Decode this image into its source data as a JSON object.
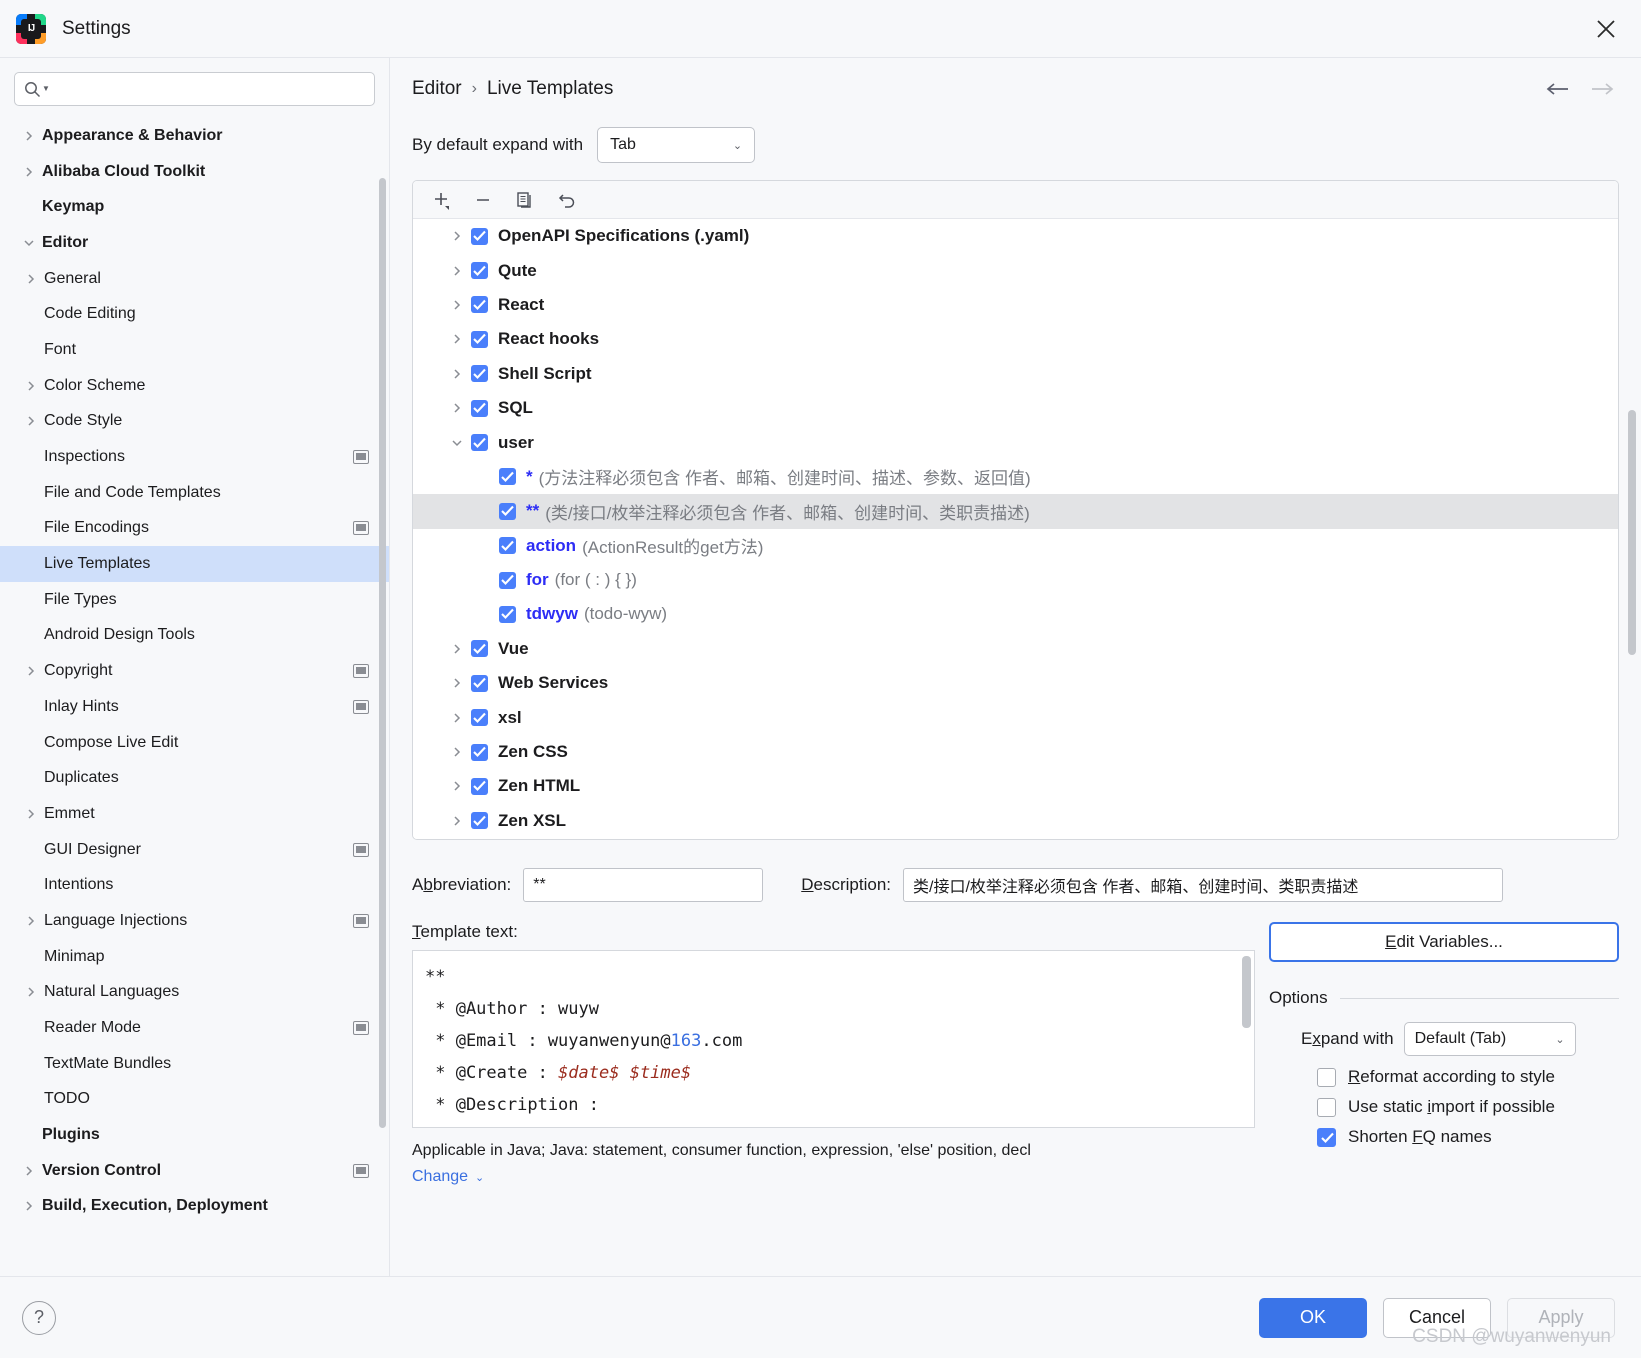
{
  "window": {
    "title": "Settings",
    "app_icon": "intellij-idea-icon",
    "close_icon": "close-icon"
  },
  "search": {
    "value": "",
    "placeholder": "",
    "icon": "search-icon"
  },
  "sidebar": {
    "items": [
      {
        "label": "Appearance & Behavior",
        "level": 1,
        "arrow": "right",
        "bold": true,
        "badge": false
      },
      {
        "label": "Alibaba Cloud Toolkit",
        "level": 1,
        "arrow": "right",
        "bold": true,
        "badge": false
      },
      {
        "label": "Keymap",
        "level": 1,
        "arrow": "none",
        "bold": true,
        "badge": false
      },
      {
        "label": "Editor",
        "level": 1,
        "arrow": "down",
        "bold": true,
        "badge": false
      },
      {
        "label": "General",
        "level": 2,
        "arrow": "right",
        "bold": false,
        "badge": false
      },
      {
        "label": "Code Editing",
        "level": 2,
        "arrow": "none",
        "bold": false,
        "badge": false
      },
      {
        "label": "Font",
        "level": 2,
        "arrow": "none",
        "bold": false,
        "badge": false
      },
      {
        "label": "Color Scheme",
        "level": 2,
        "arrow": "right",
        "bold": false,
        "badge": false
      },
      {
        "label": "Code Style",
        "level": 2,
        "arrow": "right",
        "bold": false,
        "badge": false
      },
      {
        "label": "Inspections",
        "level": 2,
        "arrow": "none",
        "bold": false,
        "badge": true
      },
      {
        "label": "File and Code Templates",
        "level": 2,
        "arrow": "none",
        "bold": false,
        "badge": false
      },
      {
        "label": "File Encodings",
        "level": 2,
        "arrow": "none",
        "bold": false,
        "badge": true
      },
      {
        "label": "Live Templates",
        "level": 2,
        "arrow": "none",
        "bold": false,
        "badge": false,
        "selected": true
      },
      {
        "label": "File Types",
        "level": 2,
        "arrow": "none",
        "bold": false,
        "badge": false
      },
      {
        "label": "Android Design Tools",
        "level": 2,
        "arrow": "none",
        "bold": false,
        "badge": false
      },
      {
        "label": "Copyright",
        "level": 2,
        "arrow": "right",
        "bold": false,
        "badge": true
      },
      {
        "label": "Inlay Hints",
        "level": 2,
        "arrow": "none",
        "bold": false,
        "badge": true
      },
      {
        "label": "Compose Live Edit",
        "level": 2,
        "arrow": "none",
        "bold": false,
        "badge": false
      },
      {
        "label": "Duplicates",
        "level": 2,
        "arrow": "none",
        "bold": false,
        "badge": false
      },
      {
        "label": "Emmet",
        "level": 2,
        "arrow": "right",
        "bold": false,
        "badge": false
      },
      {
        "label": "GUI Designer",
        "level": 2,
        "arrow": "none",
        "bold": false,
        "badge": true
      },
      {
        "label": "Intentions",
        "level": 2,
        "arrow": "none",
        "bold": false,
        "badge": false
      },
      {
        "label": "Language Injections",
        "level": 2,
        "arrow": "right",
        "bold": false,
        "badge": true
      },
      {
        "label": "Minimap",
        "level": 2,
        "arrow": "none",
        "bold": false,
        "badge": false
      },
      {
        "label": "Natural Languages",
        "level": 2,
        "arrow": "right",
        "bold": false,
        "badge": false
      },
      {
        "label": "Reader Mode",
        "level": 2,
        "arrow": "none",
        "bold": false,
        "badge": true
      },
      {
        "label": "TextMate Bundles",
        "level": 2,
        "arrow": "none",
        "bold": false,
        "badge": false
      },
      {
        "label": "TODO",
        "level": 2,
        "arrow": "none",
        "bold": false,
        "badge": false
      },
      {
        "label": "Plugins",
        "level": 1,
        "arrow": "none",
        "bold": true,
        "badge": false
      },
      {
        "label": "Version Control",
        "level": 1,
        "arrow": "right",
        "bold": true,
        "badge": true
      },
      {
        "label": "Build, Execution, Deployment",
        "level": 1,
        "arrow": "right",
        "bold": true,
        "badge": false
      }
    ]
  },
  "breadcrumb": {
    "parent": "Editor",
    "separator": "›",
    "current": "Live Templates",
    "back_icon": "arrow-left-icon",
    "forward_icon": "arrow-right-icon"
  },
  "expand_with": {
    "label": "By default expand with",
    "value": "Tab",
    "chevron": "⌄"
  },
  "toolbar": {
    "add_icon": "add-icon",
    "remove_icon": "remove-icon",
    "duplicate_icon": "duplicate-icon",
    "revert_icon": "revert-icon"
  },
  "template_tree": {
    "rows": [
      {
        "kind": "group",
        "arrow": "right",
        "label": "OpenAPI Specifications (.yaml)",
        "checked": true
      },
      {
        "kind": "group",
        "arrow": "right",
        "label": "Qute",
        "checked": true
      },
      {
        "kind": "group",
        "arrow": "right",
        "label": "React",
        "checked": true
      },
      {
        "kind": "group",
        "arrow": "right",
        "label": "React hooks",
        "checked": true
      },
      {
        "kind": "group",
        "arrow": "right",
        "label": "Shell Script",
        "checked": true
      },
      {
        "kind": "group",
        "arrow": "right",
        "label": "SQL",
        "checked": true
      },
      {
        "kind": "group",
        "arrow": "down",
        "label": "user",
        "checked": true
      },
      {
        "kind": "child",
        "label": "*",
        "desc": "(方法注释必须包含 作者、邮箱、创建时间、描述、参数、返回值)",
        "checked": true
      },
      {
        "kind": "child",
        "label": "**",
        "desc": "(类/接口/枚举注释必须包含 作者、邮箱、创建时间、类职责描述)",
        "checked": true,
        "highlighted": true
      },
      {
        "kind": "child",
        "label": "action",
        "desc": "(ActionResult的get方法)",
        "checked": true
      },
      {
        "kind": "child",
        "label": "for",
        "desc": "(for ( : ) {            })",
        "checked": true
      },
      {
        "kind": "child",
        "label": "tdwyw",
        "desc": "(todo-wyw)",
        "checked": true
      },
      {
        "kind": "group",
        "arrow": "right",
        "label": "Vue",
        "checked": true
      },
      {
        "kind": "group",
        "arrow": "right",
        "label": "Web Services",
        "checked": true
      },
      {
        "kind": "group",
        "arrow": "right",
        "label": "xsl",
        "checked": true
      },
      {
        "kind": "group",
        "arrow": "right",
        "label": "Zen CSS",
        "checked": true
      },
      {
        "kind": "group",
        "arrow": "right",
        "label": "Zen HTML",
        "checked": true
      },
      {
        "kind": "group",
        "arrow": "right",
        "label": "Zen XSL",
        "checked": true
      }
    ]
  },
  "form": {
    "abbreviation_label": "Abbreviation:",
    "abbreviation_value": "**",
    "description_label": "Description:",
    "description_value": "类/接口/枚举注释必须包含 作者、邮箱、创建时间、类职责描述"
  },
  "template_text": {
    "label": "Template text:",
    "lines": [
      {
        "text": "**"
      },
      {
        "text": " * @Author : wuyw"
      },
      {
        "pre": " * @Email : wuyanwenyun@",
        "num": "163",
        "post": ".com"
      },
      {
        "pre": " * @Create : ",
        "var": "$date$ $time$"
      },
      {
        "text": " * @Description : "
      },
      {
        "text": " *"
      }
    ]
  },
  "applicable": {
    "text": "Applicable in Java; Java: statement, consumer function, expression, 'else' position, decl",
    "change_label": "Change",
    "change_chevron": "⌄"
  },
  "options": {
    "edit_variables_label": "Edit Variables...",
    "title": "Options",
    "expand_with_label": "Expand with",
    "expand_with_value": "Default (Tab)",
    "chevron": "⌄",
    "checkboxes": [
      {
        "label": "Reformat according to style",
        "checked": false,
        "mnemonic_index": 0
      },
      {
        "label": "Use static import if possible",
        "checked": false,
        "mnemonic_index": 11
      },
      {
        "label": "Shorten FQ names",
        "checked": true,
        "mnemonic_index": 8
      }
    ]
  },
  "footer": {
    "help_label": "?",
    "ok_label": "OK",
    "cancel_label": "Cancel",
    "apply_label": "Apply",
    "watermark": "CSDN @wuyanwenyun"
  }
}
